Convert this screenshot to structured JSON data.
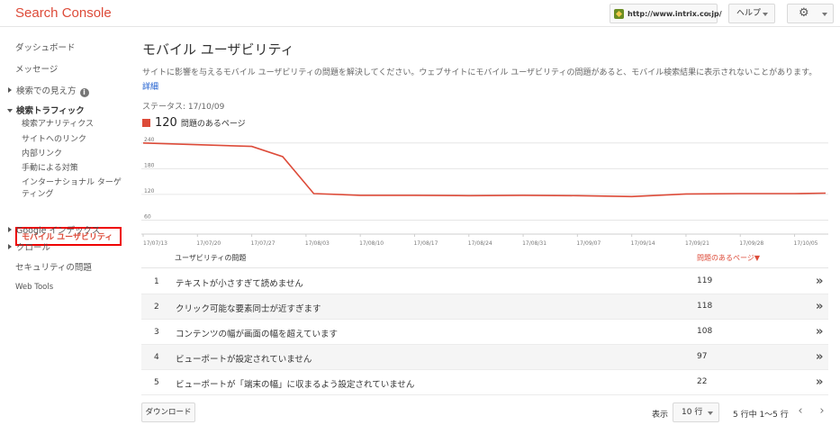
{
  "header": {
    "logo": "Search Console",
    "site": "http://www.intrix.co.jp/",
    "help": "ヘルプ",
    "settings_icon": "gear-icon"
  },
  "sidebar": {
    "dashboard": "ダッシュボード",
    "messages": "メッセージ",
    "search_appearance": "検索での見え方",
    "search_traffic": "検索トラフィック",
    "traffic_items": [
      "検索アナリティクス",
      "サイトへのリンク",
      "内部リンク",
      "手動による対策",
      "インターナショナル ターゲ",
      "ティング"
    ],
    "active_item": "モバイル ユーザビリティ",
    "google_index": "Google インデックス",
    "crawl": "クロール",
    "security": "セキュリティの問題",
    "web_tools": "Web Tools"
  },
  "main": {
    "title": "モバイル ユーザビリティ",
    "description": "サイトに影響を与えるモバイル ユーザビリティの問題を解決してください。ウェブサイトにモバイル ユーザビリティの問題があると、モバイル検索結果に表示されないことがあります。",
    "details_link": "詳細",
    "status": "ステータス: 17/10/09",
    "legend_count": "120",
    "legend_label": "問題のあるページ",
    "accent_color": "#dd4b39"
  },
  "chart_data": {
    "type": "line",
    "y_ticks": [
      "240",
      "180",
      "120",
      "60"
    ],
    "ylim": [
      40,
      250
    ],
    "x_ticks": [
      "17/07/13",
      "17/07/20",
      "17/07/27",
      "17/08/03",
      "17/08/10",
      "17/08/17",
      "17/08/24",
      "17/08/31",
      "17/09/07",
      "17/09/14",
      "17/09/21",
      "17/09/28",
      "17/10/05"
    ],
    "series": [
      {
        "color": "#dd4b39",
        "x": [
          "17/07/13",
          "17/07/20",
          "17/07/27",
          "17/07/31",
          "17/08/04",
          "17/08/10",
          "17/08/17",
          "17/08/24",
          "17/08/31",
          "17/09/07",
          "17/09/14",
          "17/09/21",
          "17/09/28",
          "17/10/05",
          "17/10/09"
        ],
        "values": [
          240,
          236,
          232,
          208,
          122,
          118,
          118,
          117,
          118,
          117,
          115,
          121,
          122,
          122,
          123
        ]
      }
    ]
  },
  "table": {
    "col_issue": "ユーザビリティの問題",
    "col_pages": "問題のあるページ▼",
    "rows": [
      {
        "num": "1",
        "issue": "テキストが小さすぎて読めません",
        "count": "119"
      },
      {
        "num": "2",
        "issue": "クリック可能な要素同士が近すぎます",
        "count": "118"
      },
      {
        "num": "3",
        "issue": "コンテンツの幅が画面の幅を超えています",
        "count": "108"
      },
      {
        "num": "4",
        "issue": "ビューポートが設定されていません",
        "count": "97"
      },
      {
        "num": "5",
        "issue": "ビューポートが「端末の幅」に収まるよう設定されていません",
        "count": "22"
      }
    ],
    "chevron": "»"
  },
  "footer": {
    "download": "ダウンロード",
    "show": "表示",
    "rows_per_page": "10 行",
    "range": "5 行中 1～5 行",
    "prev": "‹",
    "next": "›"
  }
}
